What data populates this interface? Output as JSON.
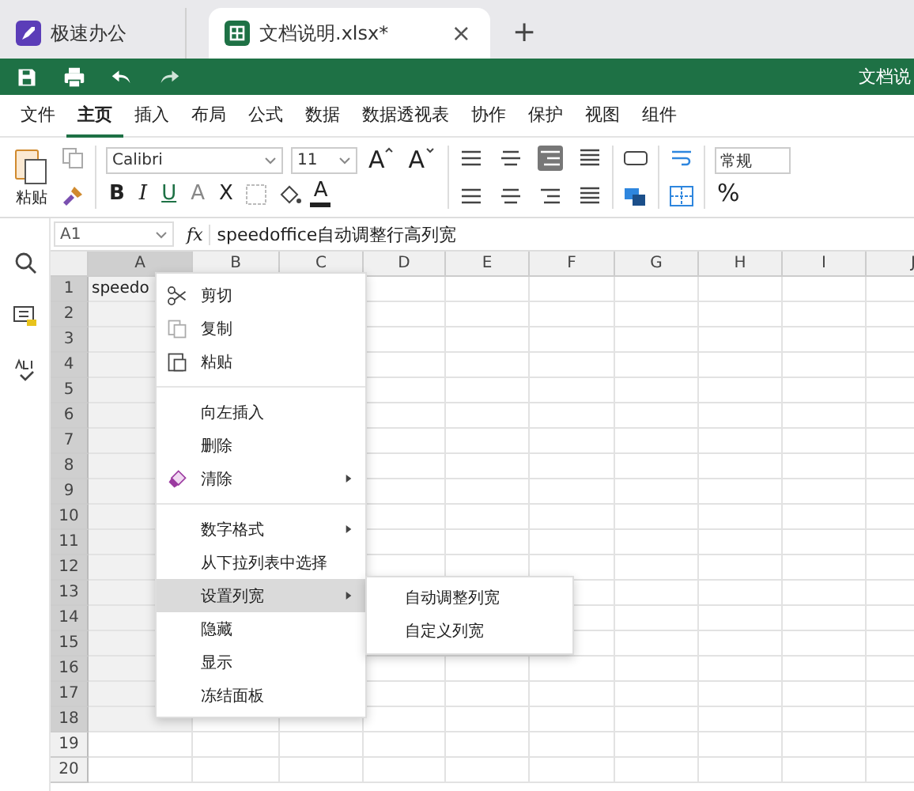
{
  "tabs": [
    {
      "label": "极速办公",
      "selected": false,
      "kind": "home"
    },
    {
      "label": "文档说明.xlsx*",
      "selected": true,
      "kind": "sheet",
      "close": "×"
    }
  ],
  "new_tab": "+",
  "toolbar": {
    "title": "文档说"
  },
  "menu_tabs": [
    {
      "label": "文件",
      "selected": false
    },
    {
      "label": "主页",
      "selected": true
    },
    {
      "label": "插入",
      "selected": false
    },
    {
      "label": "布局",
      "selected": false
    },
    {
      "label": "公式",
      "selected": false
    },
    {
      "label": "数据",
      "selected": false
    },
    {
      "label": "数据透视表",
      "selected": false
    },
    {
      "label": "协作",
      "selected": false
    },
    {
      "label": "保护",
      "selected": false
    },
    {
      "label": "视图",
      "selected": false
    },
    {
      "label": "组件",
      "selected": false
    }
  ],
  "ribbon": {
    "paste": "粘贴",
    "font": "Calibri",
    "size": "11",
    "grow": "A",
    "shrink": "A",
    "bold": "B",
    "italic": "I",
    "underline": "U",
    "strike": "A",
    "subscript": "X",
    "font_color": "A",
    "number_format": "常规",
    "percent": "%"
  },
  "formula_bar": {
    "cell": "A1",
    "fx": "fx",
    "value": "speedoffice自动调整行高列宽"
  },
  "columns": [
    {
      "label": "A",
      "selected": true
    },
    {
      "label": "B",
      "selected": false
    },
    {
      "label": "C",
      "selected": false
    },
    {
      "label": "D",
      "selected": false
    },
    {
      "label": "E",
      "selected": false
    },
    {
      "label": "F",
      "selected": false
    },
    {
      "label": "G",
      "selected": false
    },
    {
      "label": "H",
      "selected": false
    },
    {
      "label": "I",
      "selected": false
    },
    {
      "label": "J",
      "selected": false
    }
  ],
  "rows": [
    {
      "label": "1",
      "selected": true,
      "cell": "speedo"
    },
    {
      "label": "2",
      "selected": true
    },
    {
      "label": "3",
      "selected": true
    },
    {
      "label": "4",
      "selected": true
    },
    {
      "label": "5",
      "selected": true
    },
    {
      "label": "6",
      "selected": true
    },
    {
      "label": "7",
      "selected": true
    },
    {
      "label": "8",
      "selected": true
    },
    {
      "label": "9",
      "selected": true
    },
    {
      "label": "10",
      "selected": true
    },
    {
      "label": "11",
      "selected": true
    },
    {
      "label": "12",
      "selected": true
    },
    {
      "label": "13",
      "selected": true
    },
    {
      "label": "14",
      "selected": true
    },
    {
      "label": "15",
      "selected": true
    },
    {
      "label": "16",
      "selected": true
    },
    {
      "label": "17",
      "selected": true
    },
    {
      "label": "18",
      "selected": true
    },
    {
      "label": "19",
      "selected": false
    },
    {
      "label": "20",
      "selected": false
    }
  ],
  "context_menu": {
    "items": [
      {
        "kind": "item",
        "label": "剪切",
        "selected": false,
        "submenu": false
      },
      {
        "kind": "item",
        "label": "复制",
        "selected": false,
        "submenu": false
      },
      {
        "kind": "item",
        "label": "粘贴",
        "selected": false,
        "submenu": false
      },
      {
        "kind": "separator"
      },
      {
        "kind": "item",
        "label": "向左插入",
        "selected": false,
        "submenu": false
      },
      {
        "kind": "item",
        "label": "删除",
        "selected": false,
        "submenu": false
      },
      {
        "kind": "item",
        "label": "清除",
        "selected": false,
        "submenu": true
      },
      {
        "kind": "separator"
      },
      {
        "kind": "item",
        "label": "数字格式",
        "selected": false,
        "submenu": true
      },
      {
        "kind": "item",
        "label": "从下拉列表中选择",
        "selected": false,
        "submenu": false
      },
      {
        "kind": "item",
        "label": "设置列宽",
        "selected": true,
        "submenu": true
      },
      {
        "kind": "item",
        "label": "隐藏",
        "selected": false,
        "submenu": false
      },
      {
        "kind": "item",
        "label": "显示",
        "selected": false,
        "submenu": false
      },
      {
        "kind": "item",
        "label": "冻结面板",
        "selected": false,
        "submenu": false
      }
    ],
    "submenu": [
      {
        "label": "自动调整列宽"
      },
      {
        "label": "自定义列宽"
      }
    ]
  }
}
